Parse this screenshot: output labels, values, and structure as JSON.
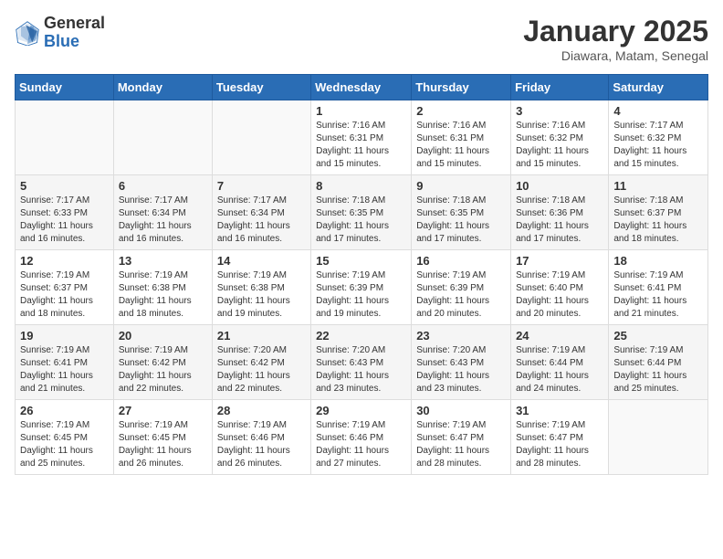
{
  "header": {
    "logo_general": "General",
    "logo_blue": "Blue",
    "month_title": "January 2025",
    "location": "Diawara, Matam, Senegal"
  },
  "weekdays": [
    "Sunday",
    "Monday",
    "Tuesday",
    "Wednesday",
    "Thursday",
    "Friday",
    "Saturday"
  ],
  "weeks": [
    [
      {
        "day": "",
        "info": ""
      },
      {
        "day": "",
        "info": ""
      },
      {
        "day": "",
        "info": ""
      },
      {
        "day": "1",
        "info": "Sunrise: 7:16 AM\nSunset: 6:31 PM\nDaylight: 11 hours and 15 minutes."
      },
      {
        "day": "2",
        "info": "Sunrise: 7:16 AM\nSunset: 6:31 PM\nDaylight: 11 hours and 15 minutes."
      },
      {
        "day": "3",
        "info": "Sunrise: 7:16 AM\nSunset: 6:32 PM\nDaylight: 11 hours and 15 minutes."
      },
      {
        "day": "4",
        "info": "Sunrise: 7:17 AM\nSunset: 6:32 PM\nDaylight: 11 hours and 15 minutes."
      }
    ],
    [
      {
        "day": "5",
        "info": "Sunrise: 7:17 AM\nSunset: 6:33 PM\nDaylight: 11 hours and 16 minutes."
      },
      {
        "day": "6",
        "info": "Sunrise: 7:17 AM\nSunset: 6:34 PM\nDaylight: 11 hours and 16 minutes."
      },
      {
        "day": "7",
        "info": "Sunrise: 7:17 AM\nSunset: 6:34 PM\nDaylight: 11 hours and 16 minutes."
      },
      {
        "day": "8",
        "info": "Sunrise: 7:18 AM\nSunset: 6:35 PM\nDaylight: 11 hours and 17 minutes."
      },
      {
        "day": "9",
        "info": "Sunrise: 7:18 AM\nSunset: 6:35 PM\nDaylight: 11 hours and 17 minutes."
      },
      {
        "day": "10",
        "info": "Sunrise: 7:18 AM\nSunset: 6:36 PM\nDaylight: 11 hours and 17 minutes."
      },
      {
        "day": "11",
        "info": "Sunrise: 7:18 AM\nSunset: 6:37 PM\nDaylight: 11 hours and 18 minutes."
      }
    ],
    [
      {
        "day": "12",
        "info": "Sunrise: 7:19 AM\nSunset: 6:37 PM\nDaylight: 11 hours and 18 minutes."
      },
      {
        "day": "13",
        "info": "Sunrise: 7:19 AM\nSunset: 6:38 PM\nDaylight: 11 hours and 18 minutes."
      },
      {
        "day": "14",
        "info": "Sunrise: 7:19 AM\nSunset: 6:38 PM\nDaylight: 11 hours and 19 minutes."
      },
      {
        "day": "15",
        "info": "Sunrise: 7:19 AM\nSunset: 6:39 PM\nDaylight: 11 hours and 19 minutes."
      },
      {
        "day": "16",
        "info": "Sunrise: 7:19 AM\nSunset: 6:39 PM\nDaylight: 11 hours and 20 minutes."
      },
      {
        "day": "17",
        "info": "Sunrise: 7:19 AM\nSunset: 6:40 PM\nDaylight: 11 hours and 20 minutes."
      },
      {
        "day": "18",
        "info": "Sunrise: 7:19 AM\nSunset: 6:41 PM\nDaylight: 11 hours and 21 minutes."
      }
    ],
    [
      {
        "day": "19",
        "info": "Sunrise: 7:19 AM\nSunset: 6:41 PM\nDaylight: 11 hours and 21 minutes."
      },
      {
        "day": "20",
        "info": "Sunrise: 7:19 AM\nSunset: 6:42 PM\nDaylight: 11 hours and 22 minutes."
      },
      {
        "day": "21",
        "info": "Sunrise: 7:20 AM\nSunset: 6:42 PM\nDaylight: 11 hours and 22 minutes."
      },
      {
        "day": "22",
        "info": "Sunrise: 7:20 AM\nSunset: 6:43 PM\nDaylight: 11 hours and 23 minutes."
      },
      {
        "day": "23",
        "info": "Sunrise: 7:20 AM\nSunset: 6:43 PM\nDaylight: 11 hours and 23 minutes."
      },
      {
        "day": "24",
        "info": "Sunrise: 7:19 AM\nSunset: 6:44 PM\nDaylight: 11 hours and 24 minutes."
      },
      {
        "day": "25",
        "info": "Sunrise: 7:19 AM\nSunset: 6:44 PM\nDaylight: 11 hours and 25 minutes."
      }
    ],
    [
      {
        "day": "26",
        "info": "Sunrise: 7:19 AM\nSunset: 6:45 PM\nDaylight: 11 hours and 25 minutes."
      },
      {
        "day": "27",
        "info": "Sunrise: 7:19 AM\nSunset: 6:45 PM\nDaylight: 11 hours and 26 minutes."
      },
      {
        "day": "28",
        "info": "Sunrise: 7:19 AM\nSunset: 6:46 PM\nDaylight: 11 hours and 26 minutes."
      },
      {
        "day": "29",
        "info": "Sunrise: 7:19 AM\nSunset: 6:46 PM\nDaylight: 11 hours and 27 minutes."
      },
      {
        "day": "30",
        "info": "Sunrise: 7:19 AM\nSunset: 6:47 PM\nDaylight: 11 hours and 28 minutes."
      },
      {
        "day": "31",
        "info": "Sunrise: 7:19 AM\nSunset: 6:47 PM\nDaylight: 11 hours and 28 minutes."
      },
      {
        "day": "",
        "info": ""
      }
    ]
  ]
}
